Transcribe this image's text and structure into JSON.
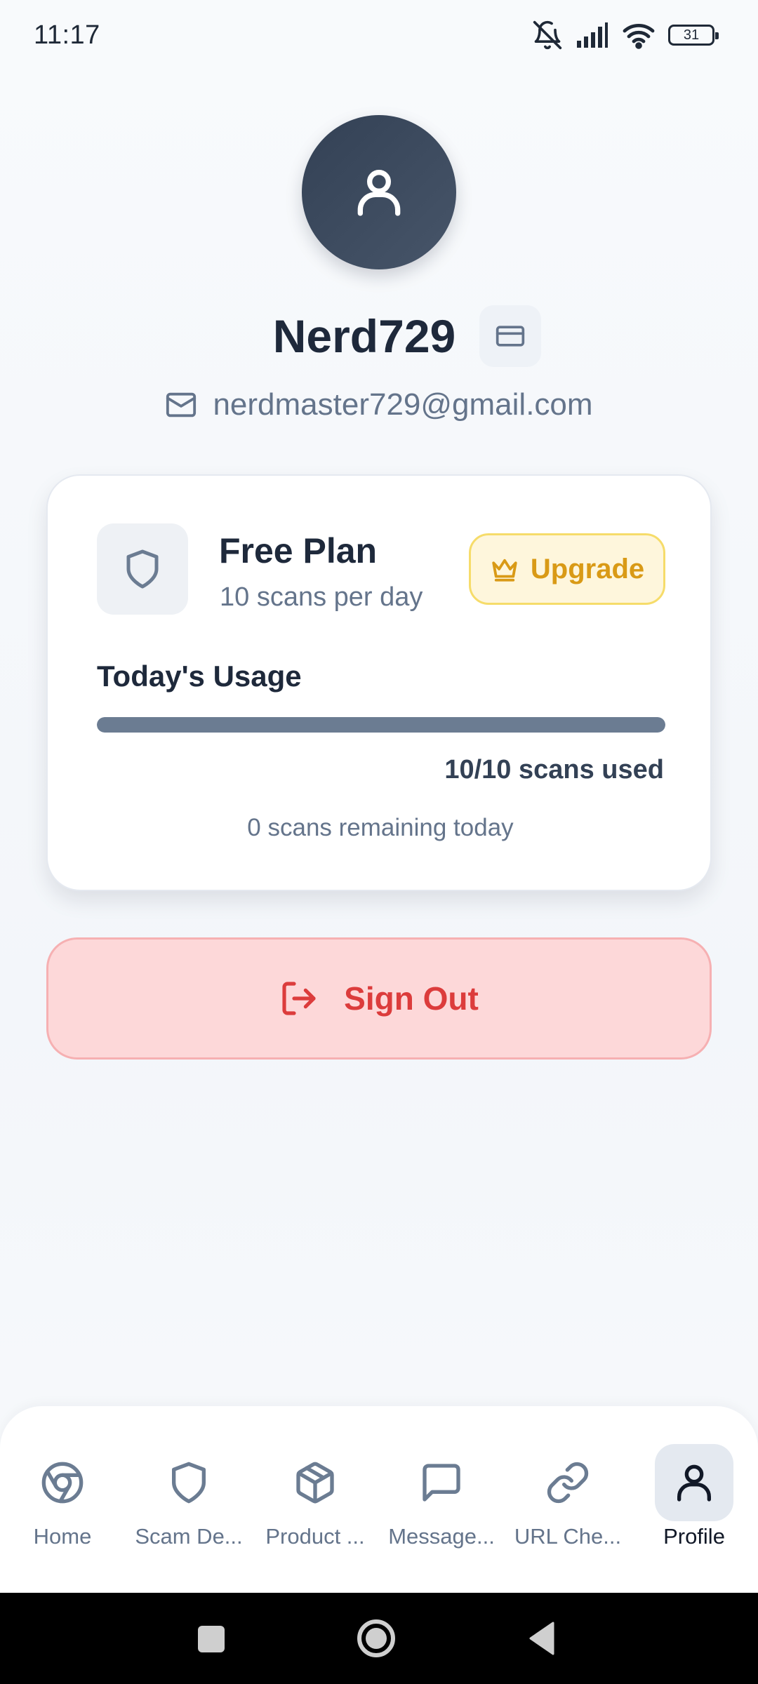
{
  "status_bar": {
    "time": "11:17",
    "battery": "31"
  },
  "profile": {
    "username": "Nerd729",
    "email": "nerdmaster729@gmail.com"
  },
  "plan": {
    "name": "Free Plan",
    "description": "10 scans per day",
    "upgrade_label": "Upgrade",
    "usage_title": "Today's Usage",
    "usage_fraction": 1.0,
    "usage_count": "10/10 scans used",
    "remaining": "0 scans remaining today"
  },
  "sign_out_label": "Sign Out",
  "nav": {
    "items": [
      {
        "label": "Home",
        "icon": "chrome-icon"
      },
      {
        "label": "Scam De...",
        "icon": "shield-icon"
      },
      {
        "label": "Product ...",
        "icon": "box-icon"
      },
      {
        "label": "Message...",
        "icon": "message-square-icon"
      },
      {
        "label": "URL Che...",
        "icon": "link-icon"
      },
      {
        "label": "Profile",
        "icon": "user-icon"
      }
    ],
    "active": "Profile"
  },
  "colors": {
    "accent_dark": "#334155",
    "upgrade": "#d99a16",
    "danger": "#dc3c3c",
    "progress": "#6b7c92"
  }
}
